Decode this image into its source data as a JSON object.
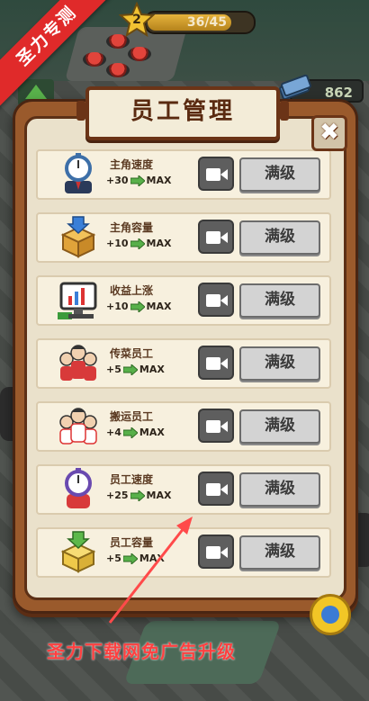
{
  "ribbon": "圣力专测",
  "level": {
    "number": "2",
    "progress_text": "36/45",
    "progress": 0.8
  },
  "money": "862",
  "dialog": {
    "title": "员工管理",
    "close_icon": "close-x-icon",
    "rows": [
      {
        "name": "主角速度",
        "value": "+30",
        "max": "MAX",
        "button": "满级",
        "icon": "stopwatch-manager-icon"
      },
      {
        "name": "主角容量",
        "value": "+10",
        "max": "MAX",
        "button": "满级",
        "icon": "box-capacity-icon"
      },
      {
        "name": "收益上涨",
        "value": "+10",
        "max": "MAX",
        "button": "满级",
        "icon": "income-monitor-icon"
      },
      {
        "name": "传菜员工",
        "value": "+5",
        "max": "MAX",
        "button": "满级",
        "icon": "waiter-staff-icon"
      },
      {
        "name": "搬运员工",
        "value": "+4",
        "max": "MAX",
        "button": "满级",
        "icon": "porter-staff-icon"
      },
      {
        "name": "员工速度",
        "value": "+25",
        "max": "MAX",
        "button": "满级",
        "icon": "staff-speed-icon"
      },
      {
        "name": "员工容量",
        "value": "+5",
        "max": "MAX",
        "button": "满级",
        "icon": "staff-capacity-icon"
      }
    ]
  },
  "annotation": "圣力下载网免广告升级",
  "colors": {
    "accent_red": "#e02a2a",
    "frame_brown": "#9a5a2c",
    "green_arrow": "#58b04a"
  }
}
